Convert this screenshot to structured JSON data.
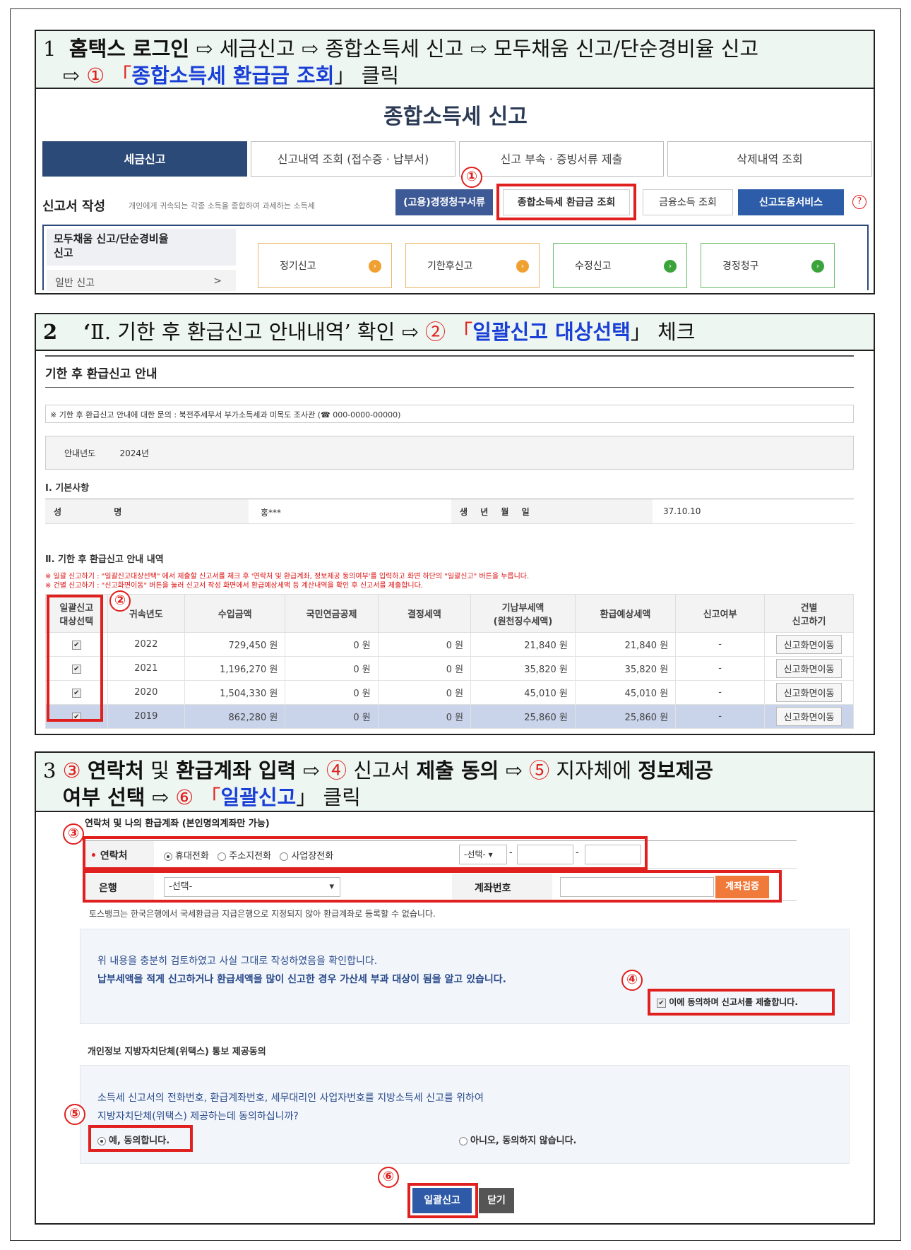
{
  "step1": {
    "num": "1",
    "lead": "홈택스 로그인",
    "arrow1": "⇨",
    "p1": "세금신고",
    "p2": "종합소득세 신고",
    "p3": "모두채움 신고/단순경비율 신고",
    "line2_arrow": "⇨",
    "circle": "①",
    "quote_open": "「",
    "target": "종합소득세 환급금 조회",
    "quote_close": "」",
    "click": "클릭",
    "screen_title": "종합소득세 신고",
    "tabs": [
      "세금신고",
      "신고내역 조회 (접수증 · 납부서)",
      "신고 부속 · 증빙서류 제출",
      "삭제내역 조회"
    ],
    "form_label": "신고서 작성",
    "form_desc": "개인에게 귀속되는 각종 소득을 종합하여 과세하는 소득세",
    "buttons": [
      "(고용)경정청구서류",
      "종합소득세 환급금 조회",
      "금융소득 조회",
      "신고도움서비스"
    ],
    "help": "?",
    "marker": "①",
    "side_menu": [
      "모두채움 신고/단순경비율\n신고",
      "일반 신고"
    ],
    "side_arrow": ">",
    "cards": [
      "정기신고",
      "기한후신고",
      "수정신고",
      "경정청구"
    ]
  },
  "step2": {
    "num": "2",
    "quote_l": "‘",
    "roman": "Ⅱ",
    "heading": ". 기한 후 환급신고 안내내역’",
    "confirm": "확인",
    "arrow": "⇨",
    "circle": "②",
    "quote_open": "「",
    "target": "일괄신고 대상선택",
    "quote_close": "」",
    "check": "체크",
    "page_title": "기한 후 환급신고 안내",
    "inquiry": "※ 기한 후 환급신고 안내에 대한 문의 : 북전주세무서 부가소득세과 미목도 조사관 (☎ 000-0000-00000)",
    "year_label": "안내년도",
    "year_value": "2024년",
    "basic_title": "Ⅰ. 기본사항",
    "name_label": "성 명",
    "name_value": "홍***",
    "birth_label": "생 년 월 일",
    "birth_value": "37.10.10",
    "detail_title": "Ⅱ. 기한 후 환급신고 안내 내역",
    "note1": "※ 일괄 신고하기 : \"일괄신고대상선택\" 에서 제출할 신고서를 체크 후 '연락처 및 환급계좌, 정보제공 동의여부'를 입력하고 화면 하단의 \"일괄신고\" 버튼을 누릅니다.",
    "note2": "※ 건별 신고하기 : \"신고화면이동\" 버튼을 눌러 신고서 작성 화면에서 환급예상세액 등 계산내역을 확인 후 신고서를 제출합니다.",
    "marker": "②",
    "columns": [
      "일괄신고\n대상선택",
      "귀속년도",
      "수입금액",
      "국민연금공제",
      "결정세액",
      "기납부세액\n(원천징수세액)",
      "환급예상세액",
      "신고여부",
      "건별\n신고하기"
    ],
    "rows": [
      {
        "check": "✔",
        "year": "2022",
        "income": "729,450 원",
        "pension": "0 원",
        "tax": "0 원",
        "prepaid": "21,840 원",
        "refund": "21,840 원",
        "status": "-",
        "btn": "신고화면이동"
      },
      {
        "check": "✔",
        "year": "2021",
        "income": "1,196,270 원",
        "pension": "0 원",
        "tax": "0 원",
        "prepaid": "35,820 원",
        "refund": "35,820 원",
        "status": "-",
        "btn": "신고화면이동"
      },
      {
        "check": "✔",
        "year": "2020",
        "income": "1,504,330 원",
        "pension": "0 원",
        "tax": "0 원",
        "prepaid": "45,010 원",
        "refund": "45,010 원",
        "status": "-",
        "btn": "신고화면이동"
      },
      {
        "check": "✔",
        "year": "2019",
        "income": "862,280 원",
        "pension": "0 원",
        "tax": "0 원",
        "prepaid": "25,860 원",
        "refund": "25,860 원",
        "status": "-",
        "btn": "신고화면이동"
      }
    ]
  },
  "step3": {
    "num": "3",
    "c3": "③",
    "t_contact": "연락처",
    "and": "및",
    "t_account": "환급계좌 입력",
    "arrow1": "⇨",
    "c4": "④",
    "t_form": "신고서",
    "t_agree": "제출 동의",
    "arrow2": "⇨",
    "c5": "⑤",
    "t_local": "지자체에",
    "t_info1": "정보제공",
    "t_info2": "여부 선택",
    "arrow3": "⇨",
    "c6": "⑥",
    "quote_open": "「",
    "target": "일괄신고",
    "quote_close": "」",
    "click": "클릭",
    "block_title": "연락처 및 나의 환급계좌 (본인명의계좌만 가능)",
    "marker3": "③",
    "contact_label": "연락처",
    "required": "•",
    "phone_options": [
      "휴대전화",
      "주소지전화",
      "사업장전화"
    ],
    "phone_prefix": "-선택-",
    "dash": "-",
    "bank_label": "은행",
    "bank_value": "-선택-",
    "account_label": "계좌번호",
    "verify_btn": "계좌검증",
    "toss_note": "토스뱅크는 한국은행에서 국세환급금 지급은행으로 지정되지 않아 환급계좌로 등록할 수 없습니다.",
    "confirm_line1": "위 내용을 충분히 검토하였고 사실 그대로 작성하였음을 확인합니다.",
    "confirm_line2": "납부세액을 적게 신고하거나 환급세액을 많이 신고한 경우 가산세 부과 대상이 됨을 알고 있습니다.",
    "marker4": "④",
    "agree_check": "이에 동의하며 신고서를 제출합니다.",
    "privacy_title": "개인정보 지방자치단체(위택스) 통보 제공동의",
    "privacy_line1": "소득세 신고서의 전화번호, 환급계좌번호, 세무대리인 사업자번호를 지방소득세 신고를 위하여",
    "privacy_line2": "지방자치단체(위택스) 제공하는데 동의하십니까?",
    "marker5": "⑤",
    "yes": "예, 동의합니다.",
    "no": "아니오, 동의하지 않습니다.",
    "marker6": "⑥",
    "submit_btn": "일괄신고",
    "close_btn": "닫기"
  }
}
